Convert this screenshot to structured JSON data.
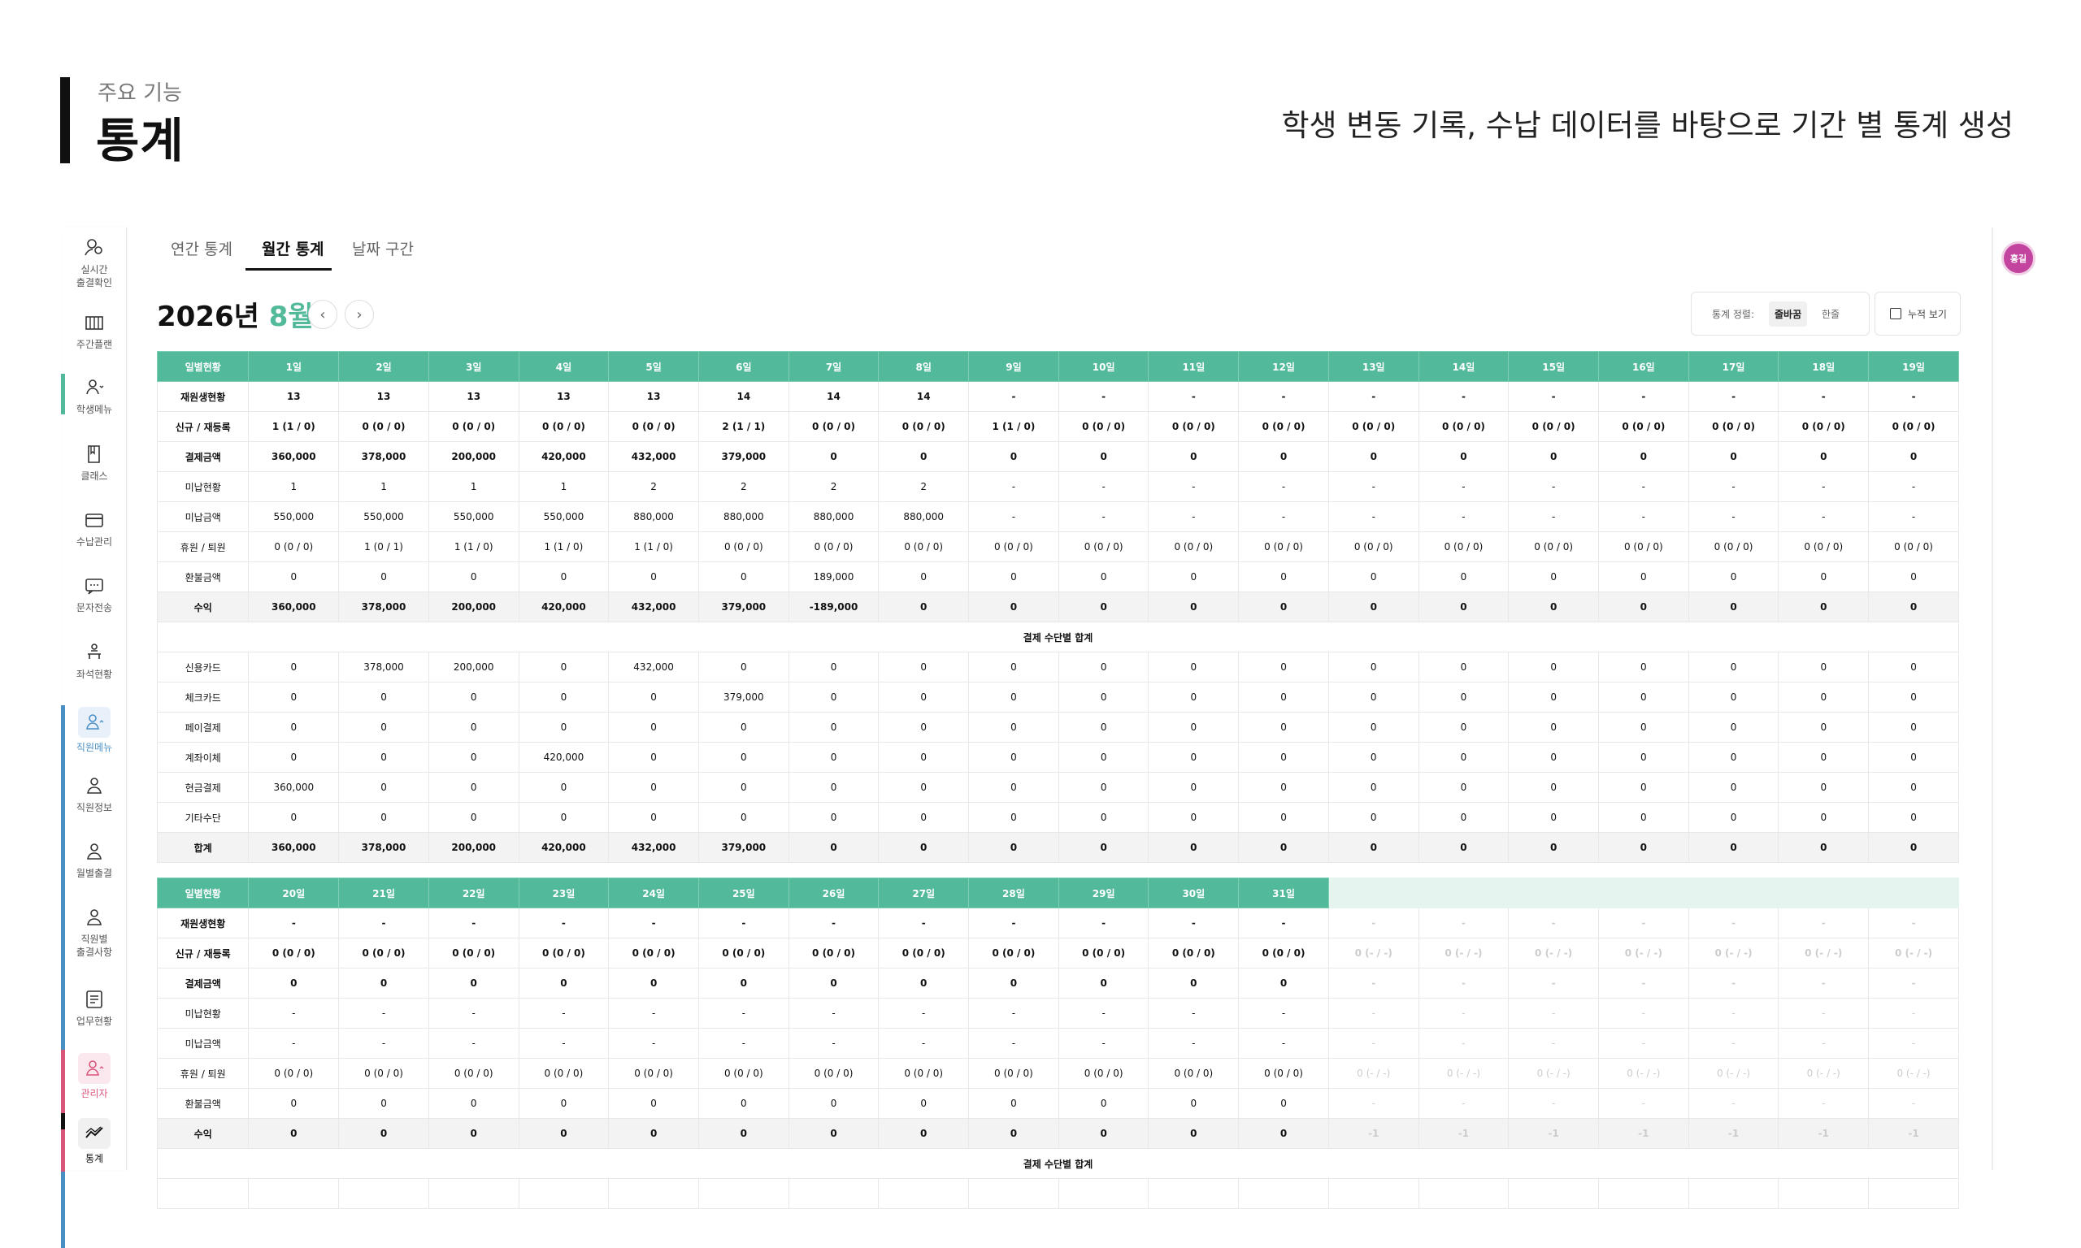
{
  "header": {
    "subtitle": "주요 기능",
    "title": "통계",
    "description": "학생 변동 기록, 수납 데이터를 바탕으로 기간 별 통계 생성"
  },
  "sidebar": {
    "items": [
      {
        "label": "실시간\n출결확인",
        "icon": "attendance-icon"
      },
      {
        "label": "주간플랜",
        "icon": "calendar-icon"
      },
      {
        "label": "학생메뉴",
        "icon": "student-icon"
      },
      {
        "label": "클래스",
        "icon": "book-icon"
      },
      {
        "label": "수납관리",
        "icon": "card-icon"
      },
      {
        "label": "문자전송",
        "icon": "message-icon"
      },
      {
        "label": "좌석현황",
        "icon": "seat-icon"
      },
      {
        "label": "직원메뉴",
        "icon": "staff-icon"
      },
      {
        "label": "직원정보",
        "icon": "person-icon"
      },
      {
        "label": "월별출결",
        "icon": "person-icon"
      },
      {
        "label": "직원별\n출결사항",
        "icon": "person-icon"
      },
      {
        "label": "업무현황",
        "icon": "task-icon"
      },
      {
        "label": "관리자",
        "icon": "admin-icon"
      },
      {
        "label": "통계",
        "icon": "chart-icon"
      }
    ],
    "accent_colors": {
      "student": "#52b99a",
      "staff": "#4a8fc4",
      "admin": "#d9557a"
    }
  },
  "avatar": {
    "label": "홍길"
  },
  "tabs": [
    {
      "label": "연간 통계"
    },
    {
      "label": "월간 통계"
    },
    {
      "label": "날짜 구간"
    }
  ],
  "month": {
    "year_label": "2026년",
    "month_label": "8월",
    "prev": "‹",
    "next": "›"
  },
  "controls": {
    "sort_label": "통계 정렬:",
    "sort_option_active": "줄바꿈",
    "sort_option_other": "한줄",
    "cumulative_label": "누적 보기"
  },
  "accent_color": "#52b99a",
  "table1": {
    "days": [
      "일별현황",
      "1일",
      "2일",
      "3일",
      "4일",
      "5일",
      "6일",
      "7일",
      "8일",
      "9일",
      "10일",
      "11일",
      "12일",
      "13일",
      "14일",
      "15일",
      "16일",
      "17일",
      "18일",
      "19일"
    ],
    "rows": [
      {
        "style": "bold",
        "cells": [
          "재원생현황",
          "13",
          "13",
          "13",
          "13",
          "13",
          "14",
          "14",
          "14",
          "-",
          "-",
          "-",
          "-",
          "-",
          "-",
          "-",
          "-",
          "-",
          "-",
          "-"
        ]
      },
      {
        "style": "bold",
        "cells": [
          "신규 / 재등록",
          "1 (1 / 0)",
          "0 (0 / 0)",
          "0 (0 / 0)",
          "0 (0 / 0)",
          "0 (0 / 0)",
          "2 (1 / 1)",
          "0 (0 / 0)",
          "0 (0 / 0)",
          "1 (1 / 0)",
          "0 (0 / 0)",
          "0 (0 / 0)",
          "0 (0 / 0)",
          "0 (0 / 0)",
          "0 (0 / 0)",
          "0 (0 / 0)",
          "0 (0 / 0)",
          "0 (0 / 0)",
          "0 (0 / 0)",
          "0 (0 / 0)"
        ]
      },
      {
        "style": "bold",
        "cells": [
          "결제금액",
          "360,000",
          "378,000",
          "200,000",
          "420,000",
          "432,000",
          "379,000",
          "0",
          "0",
          "0",
          "0",
          "0",
          "0",
          "0",
          "0",
          "0",
          "0",
          "0",
          "0",
          "0"
        ]
      },
      {
        "style": "normal",
        "cells": [
          "미납현황",
          "1",
          "1",
          "1",
          "1",
          "2",
          "2",
          "2",
          "2",
          "-",
          "-",
          "-",
          "-",
          "-",
          "-",
          "-",
          "-",
          "-",
          "-",
          "-"
        ]
      },
      {
        "style": "normal",
        "cells": [
          "미납금액",
          "550,000",
          "550,000",
          "550,000",
          "550,000",
          "880,000",
          "880,000",
          "880,000",
          "880,000",
          "-",
          "-",
          "-",
          "-",
          "-",
          "-",
          "-",
          "-",
          "-",
          "-",
          "-"
        ]
      },
      {
        "style": "normal",
        "cells": [
          "휴원 / 퇴원",
          "0 (0 / 0)",
          "1 (0 / 1)",
          "1 (1 / 0)",
          "1 (1 / 0)",
          "1 (1 / 0)",
          "0 (0 / 0)",
          "0 (0 / 0)",
          "0 (0 / 0)",
          "0 (0 / 0)",
          "0 (0 / 0)",
          "0 (0 / 0)",
          "0 (0 / 0)",
          "0 (0 / 0)",
          "0 (0 / 0)",
          "0 (0 / 0)",
          "0 (0 / 0)",
          "0 (0 / 0)",
          "0 (0 / 0)",
          "0 (0 / 0)"
        ]
      },
      {
        "style": "normal",
        "cells": [
          "환불금액",
          "0",
          "0",
          "0",
          "0",
          "0",
          "0",
          "189,000",
          "0",
          "0",
          "0",
          "0",
          "0",
          "0",
          "0",
          "0",
          "0",
          "0",
          "0",
          "0"
        ]
      },
      {
        "style": "gray",
        "cells": [
          "수익",
          "360,000",
          "378,000",
          "200,000",
          "420,000",
          "432,000",
          "379,000",
          "-189,000",
          "0",
          "0",
          "0",
          "0",
          "0",
          "0",
          "0",
          "0",
          "0",
          "0",
          "0",
          "0"
        ]
      },
      {
        "style": "sec",
        "cells": [
          "결제 수단별 합계"
        ]
      },
      {
        "style": "normal",
        "cells": [
          "신용카드",
          "0",
          "378,000",
          "200,000",
          "0",
          "432,000",
          "0",
          "0",
          "0",
          "0",
          "0",
          "0",
          "0",
          "0",
          "0",
          "0",
          "0",
          "0",
          "0",
          "0"
        ]
      },
      {
        "style": "normal",
        "cells": [
          "체크카드",
          "0",
          "0",
          "0",
          "0",
          "0",
          "379,000",
          "0",
          "0",
          "0",
          "0",
          "0",
          "0",
          "0",
          "0",
          "0",
          "0",
          "0",
          "0",
          "0"
        ]
      },
      {
        "style": "normal",
        "cells": [
          "페이결제",
          "0",
          "0",
          "0",
          "0",
          "0",
          "0",
          "0",
          "0",
          "0",
          "0",
          "0",
          "0",
          "0",
          "0",
          "0",
          "0",
          "0",
          "0",
          "0"
        ]
      },
      {
        "style": "normal",
        "cells": [
          "계좌이체",
          "0",
          "0",
          "0",
          "420,000",
          "0",
          "0",
          "0",
          "0",
          "0",
          "0",
          "0",
          "0",
          "0",
          "0",
          "0",
          "0",
          "0",
          "0",
          "0"
        ]
      },
      {
        "style": "normal",
        "cells": [
          "현금결제",
          "360,000",
          "0",
          "0",
          "0",
          "0",
          "0",
          "0",
          "0",
          "0",
          "0",
          "0",
          "0",
          "0",
          "0",
          "0",
          "0",
          "0",
          "0",
          "0"
        ]
      },
      {
        "style": "normal",
        "cells": [
          "기타수단",
          "0",
          "0",
          "0",
          "0",
          "0",
          "0",
          "0",
          "0",
          "0",
          "0",
          "0",
          "0",
          "0",
          "0",
          "0",
          "0",
          "0",
          "0",
          "0"
        ]
      },
      {
        "style": "gray",
        "cells": [
          "합계",
          "360,000",
          "378,000",
          "200,000",
          "420,000",
          "432,000",
          "379,000",
          "0",
          "0",
          "0",
          "0",
          "0",
          "0",
          "0",
          "0",
          "0",
          "0",
          "0",
          "0",
          "0"
        ]
      }
    ]
  },
  "table2": {
    "days": [
      "일별현황",
      "20일",
      "21일",
      "22일",
      "23일",
      "24일",
      "25일",
      "26일",
      "27일",
      "28일",
      "29일",
      "30일",
      "31일",
      "",
      "",
      "",
      "",
      "",
      "",
      ""
    ],
    "rows": [
      {
        "style": "bold",
        "cells": [
          "재원생현황",
          "-",
          "-",
          "-",
          "-",
          "-",
          "-",
          "-",
          "-",
          "-",
          "-",
          "-",
          "-",
          "-",
          "-",
          "-",
          "-",
          "-",
          "-",
          "-"
        ]
      },
      {
        "style": "bold",
        "cells": [
          "신규 / 재등록",
          "0 (0 / 0)",
          "0 (0 / 0)",
          "0 (0 / 0)",
          "0 (0 / 0)",
          "0 (0 / 0)",
          "0 (0 / 0)",
          "0 (0 / 0)",
          "0 (0 / 0)",
          "0 (0 / 0)",
          "0 (0 / 0)",
          "0 (0 / 0)",
          "0 (0 / 0)",
          "0 (- / -)",
          "0 (- / -)",
          "0 (- / -)",
          "0 (- / -)",
          "0 (- / -)",
          "0 (- / -)",
          "0 (- / -)"
        ]
      },
      {
        "style": "bold",
        "cells": [
          "결제금액",
          "0",
          "0",
          "0",
          "0",
          "0",
          "0",
          "0",
          "0",
          "0",
          "0",
          "0",
          "0",
          "-",
          "-",
          "-",
          "-",
          "-",
          "-",
          "-"
        ]
      },
      {
        "style": "normal",
        "cells": [
          "미납현황",
          "-",
          "-",
          "-",
          "-",
          "-",
          "-",
          "-",
          "-",
          "-",
          "-",
          "-",
          "-",
          "-",
          "-",
          "-",
          "-",
          "-",
          "-",
          "-"
        ]
      },
      {
        "style": "normal",
        "cells": [
          "미납금액",
          "-",
          "-",
          "-",
          "-",
          "-",
          "-",
          "-",
          "-",
          "-",
          "-",
          "-",
          "-",
          "-",
          "-",
          "-",
          "-",
          "-",
          "-",
          "-"
        ]
      },
      {
        "style": "normal",
        "cells": [
          "휴원 / 퇴원",
          "0 (0 / 0)",
          "0 (0 / 0)",
          "0 (0 / 0)",
          "0 (0 / 0)",
          "0 (0 / 0)",
          "0 (0 / 0)",
          "0 (0 / 0)",
          "0 (0 / 0)",
          "0 (0 / 0)",
          "0 (0 / 0)",
          "0 (0 / 0)",
          "0 (0 / 0)",
          "0 (- / -)",
          "0 (- / -)",
          "0 (- / -)",
          "0 (- / -)",
          "0 (- / -)",
          "0 (- / -)",
          "0 (- / -)"
        ]
      },
      {
        "style": "normal",
        "cells": [
          "환불금액",
          "0",
          "0",
          "0",
          "0",
          "0",
          "0",
          "0",
          "0",
          "0",
          "0",
          "0",
          "0",
          "-",
          "-",
          "-",
          "-",
          "-",
          "-",
          "-"
        ]
      },
      {
        "style": "gray",
        "cells": [
          "수익",
          "0",
          "0",
          "0",
          "0",
          "0",
          "0",
          "0",
          "0",
          "0",
          "0",
          "0",
          "0",
          "-1",
          "-1",
          "-1",
          "-1",
          "-1",
          "-1",
          "-1"
        ]
      },
      {
        "style": "sec",
        "cells": [
          "결제 수단별 합계"
        ]
      },
      {
        "style": "normal",
        "cells": [
          "",
          "",
          "",
          "",
          "",
          "",
          "",
          "",
          "",
          "",
          "",
          "",
          "",
          "",
          "",
          "",
          "",
          "",
          "",
          ""
        ]
      }
    ],
    "faded_from_column": 13
  }
}
